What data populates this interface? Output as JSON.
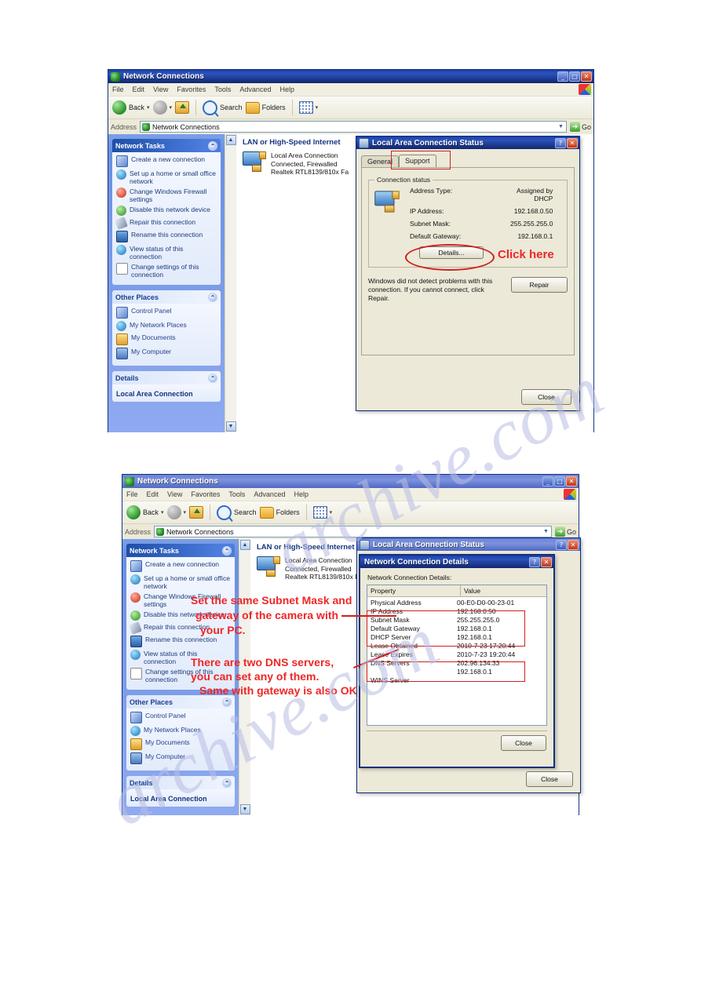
{
  "watermark": {
    "text1": "archive.com",
    "text2": "archive.com"
  },
  "window1": {
    "title": "Network Connections",
    "icon": "network-connections-icon",
    "caption": {
      "minimize": "_",
      "maximize": "□",
      "close": "✕"
    },
    "menu": [
      "File",
      "Edit",
      "View",
      "Favorites",
      "Tools",
      "Advanced",
      "Help"
    ],
    "toolbar": {
      "back": "Back",
      "search": "Search",
      "folders": "Folders"
    },
    "address": {
      "label": "Address",
      "value": "Network Connections",
      "go": "Go"
    },
    "sidebar": {
      "tasks": {
        "title": "Network Tasks",
        "items": [
          {
            "label": "Create a new connection",
            "icon": "new-connection-icon"
          },
          {
            "label": "Set up a home or small office network",
            "icon": "home-network-icon"
          },
          {
            "label": "Change Windows Firewall settings",
            "icon": "firewall-icon"
          },
          {
            "label": "Disable this network device",
            "icon": "disable-device-icon"
          },
          {
            "label": "Repair this connection",
            "icon": "repair-icon"
          },
          {
            "label": "Rename this connection",
            "icon": "rename-icon"
          },
          {
            "label": "View status of this connection",
            "icon": "view-status-icon"
          },
          {
            "label": "Change settings of this connection",
            "icon": "change-settings-icon"
          }
        ]
      },
      "places": {
        "title": "Other Places",
        "items": [
          {
            "label": "Control Panel",
            "icon": "control-panel-icon"
          },
          {
            "label": "My Network Places",
            "icon": "my-network-places-icon"
          },
          {
            "label": "My Documents",
            "icon": "my-documents-icon"
          },
          {
            "label": "My Computer",
            "icon": "my-computer-icon"
          }
        ]
      },
      "details": {
        "title": "Details",
        "name": "Local Area Connection"
      }
    },
    "content": {
      "group_header": "LAN or High-Speed Internet",
      "connection": {
        "name": "Local Area Connection",
        "status": "Connected, Firewalled",
        "adapter": "Realtek RTL8139/810x Fa"
      }
    }
  },
  "dialog1": {
    "title": "Local Area Connection Status",
    "help_btn": "?",
    "close_btn": "✕",
    "tabs": [
      {
        "label": "General",
        "active": false
      },
      {
        "label": "Support",
        "active": true
      }
    ],
    "group_title": "Connection status",
    "rows": [
      {
        "key": "Address Type:",
        "value": "Assigned by DHCP"
      },
      {
        "key": "IP Address:",
        "value": "192.168.0.50"
      },
      {
        "key": "Subnet Mask:",
        "value": "255.255.255.0"
      },
      {
        "key": "Default Gateway:",
        "value": "192.168.0.1"
      }
    ],
    "details_button": "Details...",
    "help_text": "Windows did not detect problems with this connection. If you cannot connect, click Repair.",
    "repair_button": "Repair",
    "close_button": "Close",
    "annotation_click_here": "Click here"
  },
  "window2": {
    "title": "Network Connections",
    "menu": [
      "File",
      "Edit",
      "View",
      "Favorites",
      "Tools",
      "Advanced",
      "Help"
    ],
    "toolbar": {
      "back": "Back",
      "search": "Search",
      "folders": "Folders"
    },
    "address": {
      "label": "Address",
      "value": "Network Connections",
      "go": "Go"
    },
    "sidebar": {
      "tasks": {
        "title": "Network Tasks",
        "items": [
          {
            "label": "Create a new connection",
            "icon": "new-connection-icon"
          },
          {
            "label": "Set up a home or small office network",
            "icon": "home-network-icon"
          },
          {
            "label": "Change Windows Firewall settings",
            "icon": "firewall-icon"
          },
          {
            "label": "Disable this network device",
            "icon": "disable-device-icon"
          },
          {
            "label": "Repair this connection",
            "icon": "repair-icon"
          },
          {
            "label": "Rename this connection",
            "icon": "rename-icon"
          },
          {
            "label": "View status of this connection",
            "icon": "view-status-icon"
          },
          {
            "label": "Change settings of this connection",
            "icon": "change-settings-icon"
          }
        ]
      },
      "places": {
        "title": "Other Places",
        "items": [
          {
            "label": "Control Panel",
            "icon": "control-panel-icon"
          },
          {
            "label": "My Network Places",
            "icon": "my-network-places-icon"
          },
          {
            "label": "My Documents",
            "icon": "my-documents-icon"
          },
          {
            "label": "My Computer",
            "icon": "my-computer-icon"
          }
        ]
      },
      "details": {
        "title": "Details",
        "name": "Local Area Connection"
      }
    },
    "content": {
      "group_header": "LAN or High-Speed Internet",
      "connection": {
        "name": "Local Area Connection",
        "status": "Connected, Firewalled",
        "adapter": "Realtek RTL8139/810x Fa"
      }
    }
  },
  "dialog2_status": {
    "title": "Local Area Connection Status",
    "help_btn": "?",
    "close_btn": "✕",
    "close_button": "Close"
  },
  "dialog2_details": {
    "title": "Network Connection Details",
    "help_btn": "?",
    "close_btn": "✕",
    "section_label": "Network Connection Details:",
    "columns": [
      "Property",
      "Value"
    ],
    "rows": [
      {
        "property": "Physical Address",
        "value": "00-E0-D0-00-23-01"
      },
      {
        "property": "IP Address",
        "value": "192.168.0.50"
      },
      {
        "property": "Subnet Mask",
        "value": "255.255.255.0"
      },
      {
        "property": "Default Gateway",
        "value": "192.168.0.1"
      },
      {
        "property": "DHCP Server",
        "value": "192.168.0.1"
      },
      {
        "property": "Lease Obtained",
        "value": "2010-7-23 17:20:44"
      },
      {
        "property": "Lease Expires",
        "value": "2010-7-23 19:20:44"
      },
      {
        "property": "DNS Servers",
        "value": "202.96.134.33"
      },
      {
        "property": "",
        "value": "192.168.0.1"
      },
      {
        "property": "WINS Server",
        "value": ""
      }
    ],
    "close_button": "Close"
  },
  "annotations": {
    "a1_line1": "Set the same Subnet Mask and",
    "a1_line2": "gateway of the camera with",
    "a1_line3": "your PC.",
    "a2_line1": "There are two DNS servers,",
    "a2_line2": "you can set any of them.",
    "a2_line3": "Same with gateway is also OK"
  },
  "colors": {
    "annotation_red": "#ef2626",
    "titlebar_blue": "#16337c",
    "sidebar_blue": "#7ba0e8",
    "panel_header": "#1d4ea8"
  }
}
